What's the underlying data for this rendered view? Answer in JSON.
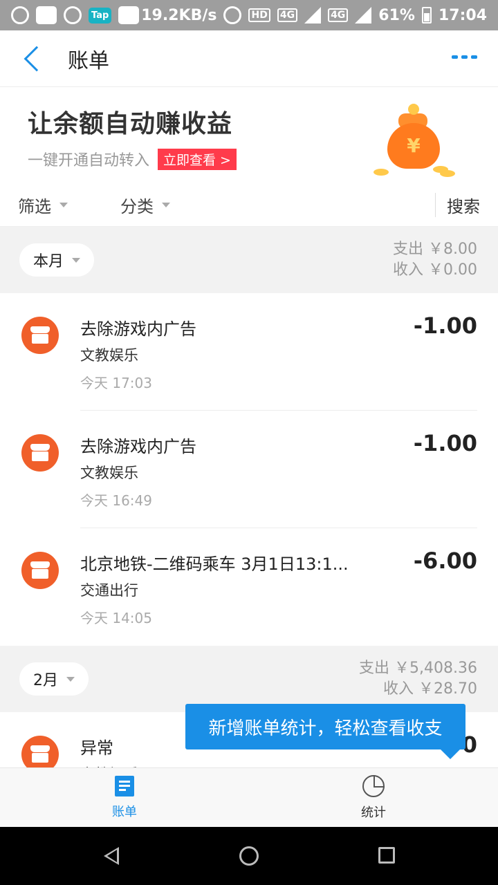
{
  "status_bar": {
    "speed": "19.2KB/s",
    "net1": "4G",
    "net2": "4G",
    "battery": "61%",
    "time": "17:04",
    "tap_label": "Tap"
  },
  "header": {
    "title": "账单"
  },
  "banner": {
    "title": "让余额自动赚收益",
    "subtitle": "一键开通自动转入",
    "button": "立即查看 >",
    "bag_symbol": "¥"
  },
  "filters": {
    "filter": "筛选",
    "category": "分类",
    "search": "搜索"
  },
  "sections": [
    {
      "month": "本月",
      "expense": "支出 ￥8.00",
      "income": "收入 ￥0.00",
      "items": [
        {
          "name": "去除游戏内广告",
          "category": "文教娱乐",
          "time": "今天  17:03",
          "amount": "-1.00"
        },
        {
          "name": "去除游戏内广告",
          "category": "文教娱乐",
          "time": "今天  16:49",
          "amount": "-1.00"
        },
        {
          "name": "北京地铁-二维码乘车 3月1日13:1...",
          "category": "交通出行",
          "time": "今天  14:05",
          "amount": "-6.00"
        }
      ]
    },
    {
      "month": "2月",
      "expense": "支出 ￥5,408.36",
      "income": "收入 ￥28.70",
      "items": [
        {
          "name": "异常",
          "category": "文教娱乐",
          "time": "",
          "amount": "0"
        }
      ]
    }
  ],
  "tooltip": "新增账单统计，轻松查看收支",
  "tabs": {
    "bills": "账单",
    "stats": "统计"
  },
  "colors": {
    "accent": "#1a8fe6",
    "badge_red": "#ff3b4b",
    "icon_orange": "#f05f2a"
  }
}
